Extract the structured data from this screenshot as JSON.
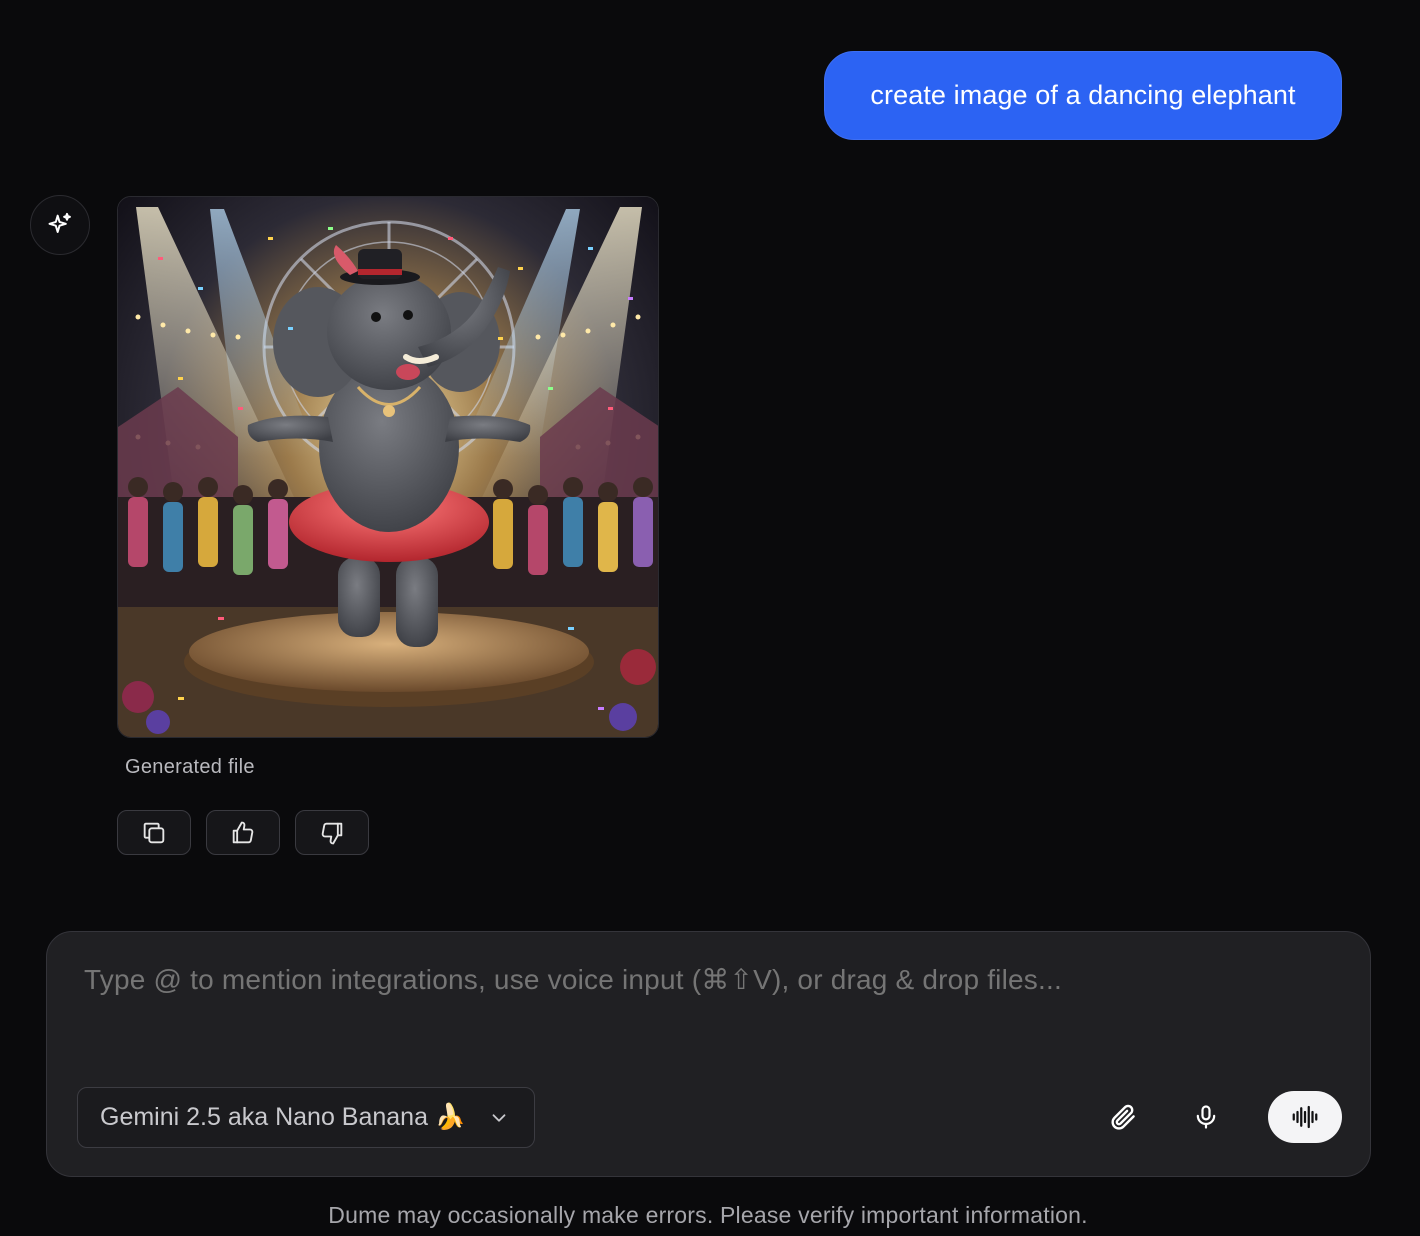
{
  "user_message": {
    "text": "create image of a dancing elephant"
  },
  "assistant": {
    "avatar_icon": "sparkles-icon",
    "image": {
      "subject": "dancing elephant",
      "caption": "Generated file"
    },
    "actions": [
      {
        "icon": "copy-icon"
      },
      {
        "icon": "thumbs-up-icon"
      },
      {
        "icon": "thumbs-down-icon"
      }
    ]
  },
  "composer": {
    "placeholder": "Type @ to mention integrations, use voice input (⌘⇧V), or drag & drop files...",
    "model_label": "Gemini 2.5 aka Nano Banana 🍌",
    "buttons": {
      "attach_icon": "paperclip-icon",
      "mic_icon": "microphone-icon",
      "voice_icon": "waveform-icon"
    }
  },
  "disclaimer": "Dume may occasionally make errors. Please verify important information.",
  "colors": {
    "accent": "#2c63f3",
    "background": "#0a0a0c",
    "composer": "#202023"
  }
}
